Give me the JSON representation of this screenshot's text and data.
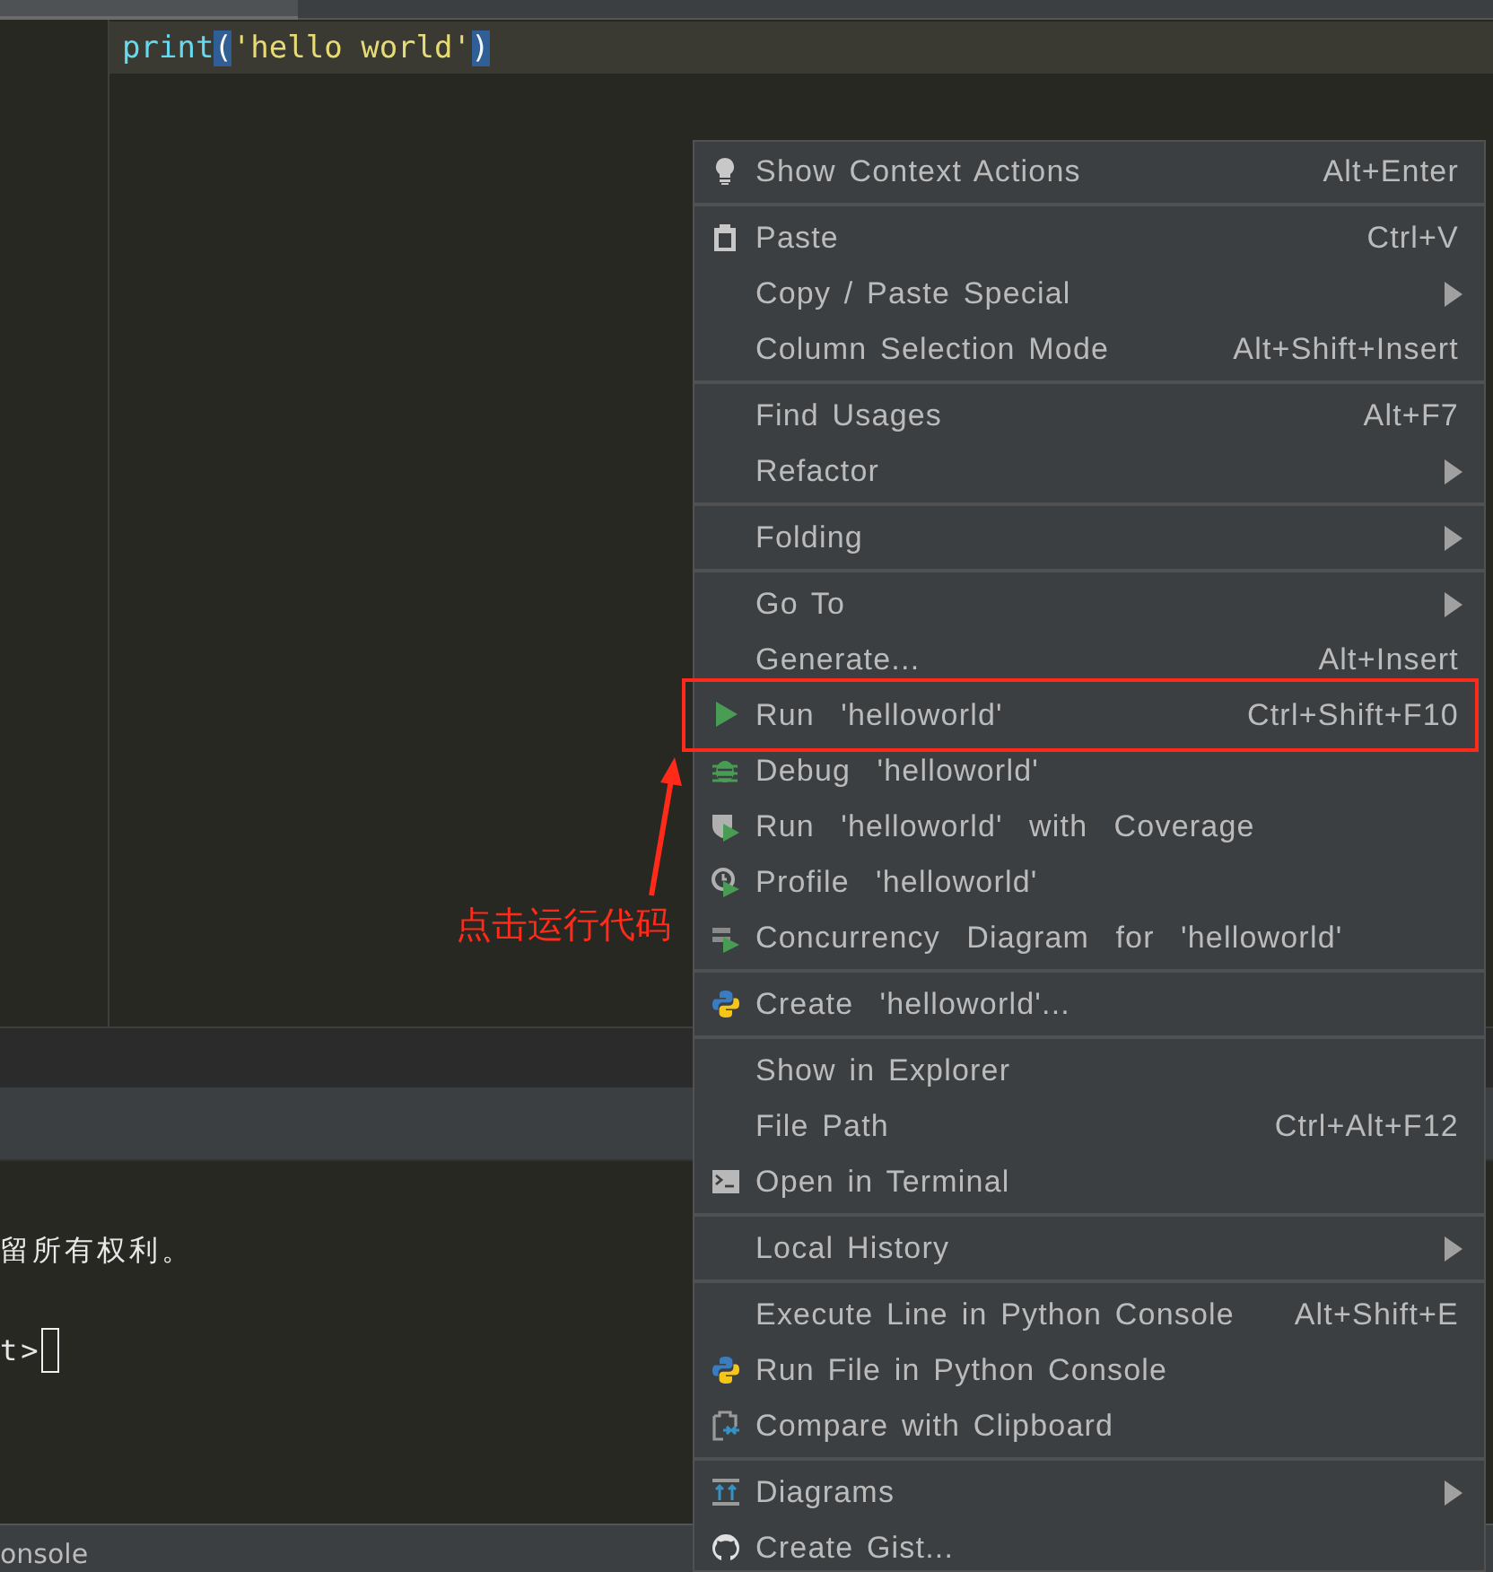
{
  "editor": {
    "code_line": [
      {
        "kind": "func",
        "text": "print"
      },
      {
        "kind": "brace",
        "text": "("
      },
      {
        "kind": "str",
        "text": "'hello world'"
      },
      {
        "kind": "brace",
        "text": ")"
      }
    ]
  },
  "console": {
    "lines": [
      "留所有权利。",
      "t>"
    ],
    "tab_label": "onsole"
  },
  "context_menu": {
    "groups": [
      {
        "items": [
          {
            "label": "Show Context Actions",
            "shortcut": "Alt+Enter",
            "submenu": false
          }
        ]
      },
      {
        "items": [
          {
            "label": "Paste",
            "shortcut": "Ctrl+V",
            "submenu": false
          },
          {
            "label": "Copy / Paste Special",
            "submenu": true
          },
          {
            "label": "Column Selection Mode",
            "shortcut": "Alt+Shift+Insert",
            "submenu": false
          }
        ]
      },
      {
        "items": [
          {
            "label": "Find Usages",
            "shortcut": "Alt+F7",
            "submenu": false
          },
          {
            "label": "Refactor",
            "submenu": true
          }
        ]
      },
      {
        "items": [
          {
            "label": "Folding",
            "submenu": true
          }
        ]
      },
      {
        "items": [
          {
            "label": "Go To",
            "submenu": true
          },
          {
            "label": "Generate...",
            "shortcut": "Alt+Insert",
            "submenu": false
          },
          {
            "label": "Run  'helloworld'",
            "shortcut": "Ctrl+Shift+F10",
            "submenu": false
          },
          {
            "label": "Debug  'helloworld'",
            "submenu": false
          },
          {
            "label": "Run  'helloworld'  with  Coverage",
            "submenu": false
          },
          {
            "label": "Profile  'helloworld'",
            "submenu": false
          },
          {
            "label": "Concurrency  Diagram  for  'helloworld'",
            "submenu": false
          }
        ]
      },
      {
        "items": [
          {
            "label": "Create  'helloworld'...",
            "submenu": false
          }
        ]
      },
      {
        "items": [
          {
            "label": "Show in Explorer",
            "submenu": false
          },
          {
            "label": "File Path",
            "shortcut": "Ctrl+Alt+F12",
            "submenu": false
          },
          {
            "label": "Open in Terminal",
            "submenu": false
          }
        ]
      },
      {
        "items": [
          {
            "label": "Local History",
            "submenu": true
          }
        ]
      },
      {
        "items": [
          {
            "label": "Execute Line in Python Console",
            "shortcut": "Alt+Shift+E",
            "submenu": false
          },
          {
            "label": "Run File in Python Console",
            "submenu": false
          },
          {
            "label": "Compare with Clipboard",
            "submenu": false
          }
        ]
      },
      {
        "items": [
          {
            "label": "Diagrams",
            "submenu": true
          },
          {
            "label": "Create Gist...",
            "submenu": false
          }
        ]
      }
    ]
  },
  "annotation": {
    "text": "点击运行代码"
  }
}
